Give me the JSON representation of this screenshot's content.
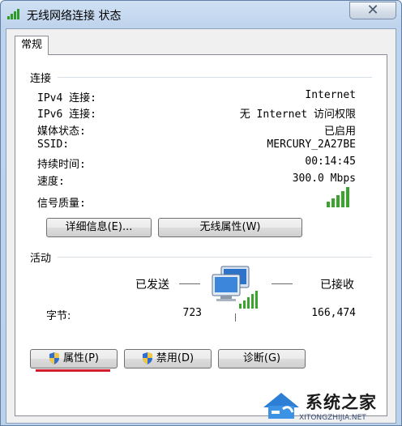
{
  "window": {
    "title": "无线网络连接 状态",
    "close_glyph": "✕"
  },
  "tabs": [
    {
      "label": "常规"
    }
  ],
  "connection": {
    "section_label": "连接",
    "rows": [
      {
        "label": "IPv4 连接:",
        "value": "Internet"
      },
      {
        "label": "IPv6 连接:",
        "value": "无 Internet 访问权限"
      },
      {
        "label": "媒体状态:",
        "value": "已启用"
      },
      {
        "label": "SSID:",
        "value": "MERCURY_2A27BE"
      },
      {
        "label": "持续时间:",
        "value": "00:14:45"
      },
      {
        "label": "速度:",
        "value": "300.0 Mbps"
      }
    ],
    "signal_label": "信号质量:",
    "signal_bars": 5,
    "details_button": "详细信息(E)...",
    "wireless_props_button": "无线属性(W)"
  },
  "activity": {
    "section_label": "活动",
    "sent_label": "已发送",
    "received_label": "已接收",
    "bytes_label": "字节:",
    "bytes_sent": "723",
    "bytes_received": "166,474"
  },
  "buttons": {
    "properties": "属性(P)",
    "disable": "禁用(D)",
    "diagnose": "诊断(G)"
  },
  "watermark": {
    "text": "系统之家",
    "subtext": "XITONGZHIJIA.NET"
  },
  "colors": {
    "signal_green": "#3aa52c",
    "highlight_red": "#d21d2f",
    "title_gradient_top": "#cfe0f3"
  },
  "icons": {
    "title": "wifi-signal-icon",
    "shield": "uac-shield-icon",
    "network": "network-computers-icon"
  }
}
